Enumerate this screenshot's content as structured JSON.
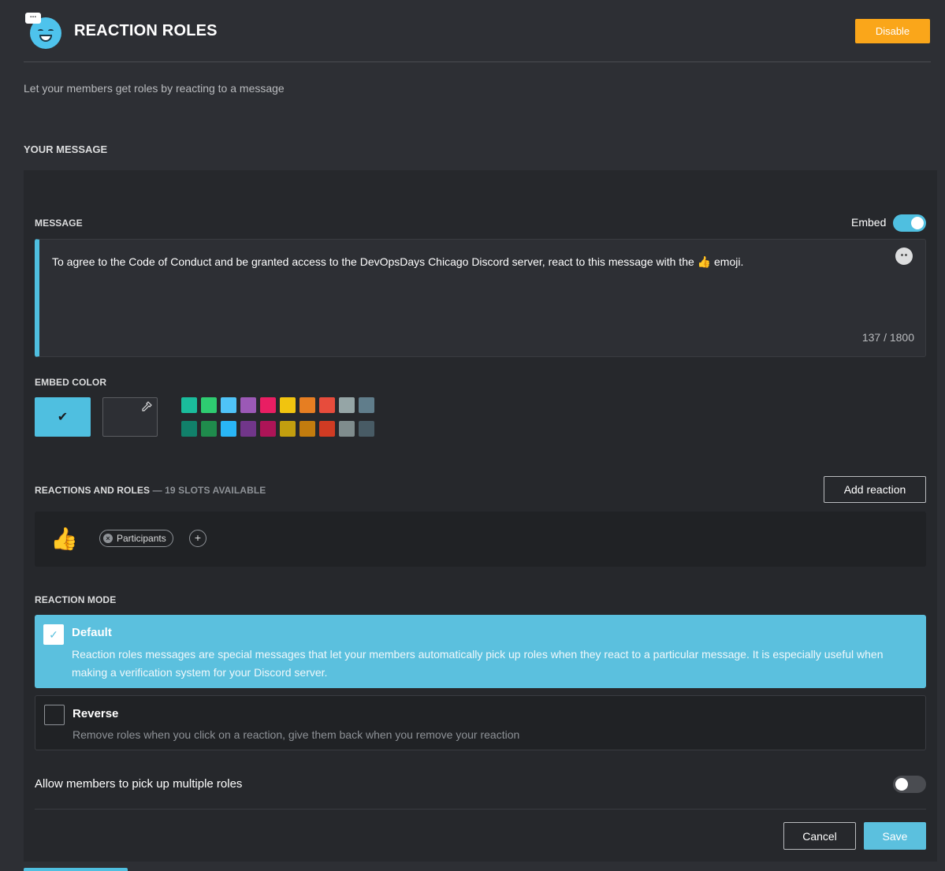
{
  "header": {
    "title": "REACTION ROLES",
    "logo_icon": "smiling-face-with-speech-bubble",
    "disable_label": "Disable",
    "disable_color": "#faa61a"
  },
  "subtitle": "Let your members get roles by reacting to a message",
  "section_title": "YOUR MESSAGE",
  "message": {
    "label": "MESSAGE",
    "embed_label": "Embed",
    "embed_on": true,
    "text_before": "To agree to the Code of Conduct and be granted access to the DevOpsDays Chicago Discord server, react to this message with the",
    "text_emoji": "👍",
    "text_after": "emoji.",
    "counter": "137 / 1800",
    "accent": "#4fbfe0"
  },
  "embed_color": {
    "label": "EMBED COLOR",
    "selected_check": "✔",
    "picker_icon": "eyedropper-icon",
    "swatches_row1": [
      "#1abc9c",
      "#2ecc71",
      "#4fc3f7",
      "#9b59b6",
      "#e91e63",
      "#f1c40f",
      "#e67e22",
      "#e74c3c",
      "#95a5a6",
      "#607d8b"
    ],
    "swatches_row2": [
      "#11806a",
      "#1f8b4c",
      "#29b6f6",
      "#71368a",
      "#ad1457",
      "#c29e0f",
      "#c27c0e",
      "#d03b23",
      "#7f8c8d",
      "#485b65"
    ]
  },
  "reactions": {
    "label": "REACTIONS AND ROLES",
    "slots_text": " — 19 SLOTS AVAILABLE",
    "add_label": "Add reaction",
    "items": [
      {
        "emoji": "👍",
        "roles": [
          "Participants"
        ]
      }
    ]
  },
  "reaction_mode": {
    "label": "REACTION MODE",
    "options": [
      {
        "title": "Default",
        "selected": true,
        "description": "Reaction roles messages are special messages that let your members automatically pick up roles when they react to a particular message. It is especially useful when making a verification system for your Discord server."
      },
      {
        "title": "Reverse",
        "selected": false,
        "description": "Remove roles when you click on a reaction, give them back when you remove your reaction"
      }
    ]
  },
  "allow_multiple": {
    "label": "Allow members to pick up multiple roles",
    "enabled": false
  },
  "footer": {
    "cancel_label": "Cancel",
    "save_label": "Save"
  }
}
